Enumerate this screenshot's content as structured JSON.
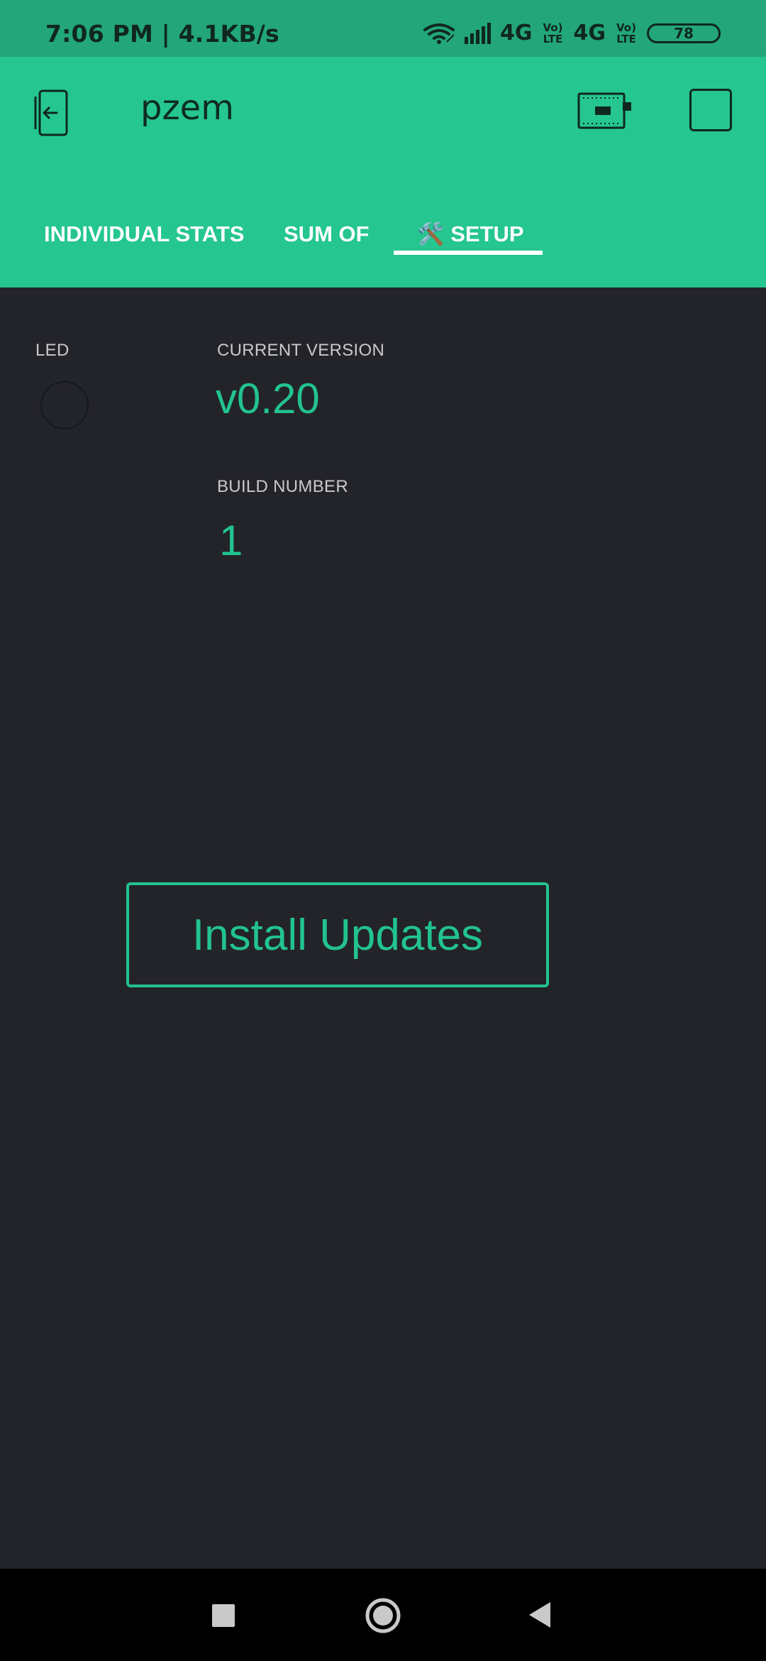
{
  "status_bar": {
    "time_and_speed": "7:06 PM | 4.1KB/s",
    "network_1": "4G",
    "network_2": "4G",
    "volte_1": "Vo) LTE",
    "volte_2": "Vo) LTE",
    "battery_level": "78",
    "icons": [
      "wifi-icon",
      "signal-icon",
      "battery-icon"
    ]
  },
  "header": {
    "title": "pzem",
    "back_icon": "back-exit-icon",
    "device_icon": "device-board-icon",
    "stop_icon": "stop-square-icon"
  },
  "tabs": [
    {
      "label": "INDIVIDUAL STATS",
      "active": false
    },
    {
      "label": "SUM OF",
      "active": false
    },
    {
      "label": "🛠️ SETUP",
      "active": true
    }
  ],
  "content": {
    "led_label": "LED",
    "version_label": "CURRENT VERSION",
    "version_value": "v0.20",
    "build_label": "BUILD NUMBER",
    "build_value": "1",
    "install_button": "Install Updates"
  },
  "navigation": {
    "buttons": [
      "recent-apps-icon",
      "home-icon",
      "back-icon"
    ]
  },
  "colors": {
    "header_green": "#25c690",
    "status_green": "#22a67a",
    "accent_green": "#22c38e",
    "background": "#23232a",
    "nav_bar": "#000000"
  }
}
